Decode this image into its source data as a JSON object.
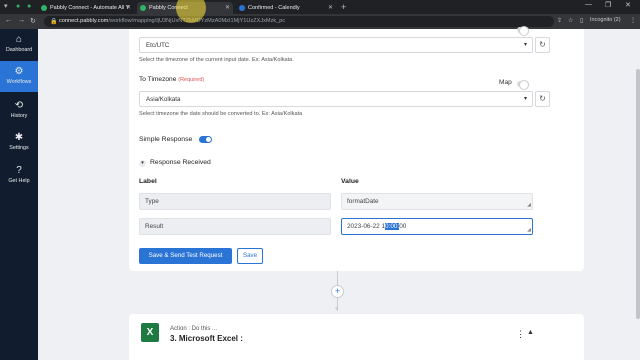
{
  "browser": {
    "tabs": [
      {
        "title": "Pabbly Connect - Automate All Y",
        "fav_color": "#2fb36a"
      },
      {
        "title": "Pabbly Connect",
        "fav_color": "#2fb36a"
      },
      {
        "title": "Confirmed - Calendly",
        "fav_color": "#2a74d5"
      }
    ],
    "new_tab": "+",
    "url_host": "connect.pabbly.com",
    "url_path": "/workflow/mapping/IjU3NjUxNTZkMDYzMzA0MzI1MjY1UzZXJxMzk_pc",
    "incognito": "Incognito (2)"
  },
  "sidebar": {
    "items": [
      {
        "label": "Dashboard",
        "icon": "home-icon"
      },
      {
        "label": "Workflows",
        "icon": "workflow-icon"
      },
      {
        "label": "History",
        "icon": "history-icon"
      },
      {
        "label": "Settings",
        "icon": "gear-icon"
      },
      {
        "label": "Get Help",
        "icon": "help-icon"
      }
    ]
  },
  "form": {
    "input_timezone_value": "Etc/UTC",
    "input_timezone_help": "Select the timezone of the current input date. Ex: Asia/Kolkata.",
    "to_timezone_label": "To Timezone",
    "required_text": "(Required)",
    "map_label": "Map",
    "to_timezone_value": "Asia/Kolkata",
    "to_timezone_help": "Select timezone the date should be converted to. Ex: Asia/Kolkata",
    "simple_response_label": "Simple Response"
  },
  "response": {
    "heading": "Response Received",
    "col_label": "Label",
    "col_value": "Value",
    "rows": [
      {
        "label": "Type",
        "value": "formatDate"
      },
      {
        "label": "Result",
        "value_pre": "2023-06-22 1",
        "value_selected": "0:00:",
        "value_post": "00"
      }
    ]
  },
  "buttons": {
    "save_send": "Save & Send Test Request",
    "save": "Save"
  },
  "next_step": {
    "tag": "Action : Do this ...",
    "title": "3. Microsoft Excel :"
  },
  "colors": {
    "accent": "#2a74d5",
    "sidebar_bg": "#111d2e",
    "excel_green": "#1e7a43"
  }
}
